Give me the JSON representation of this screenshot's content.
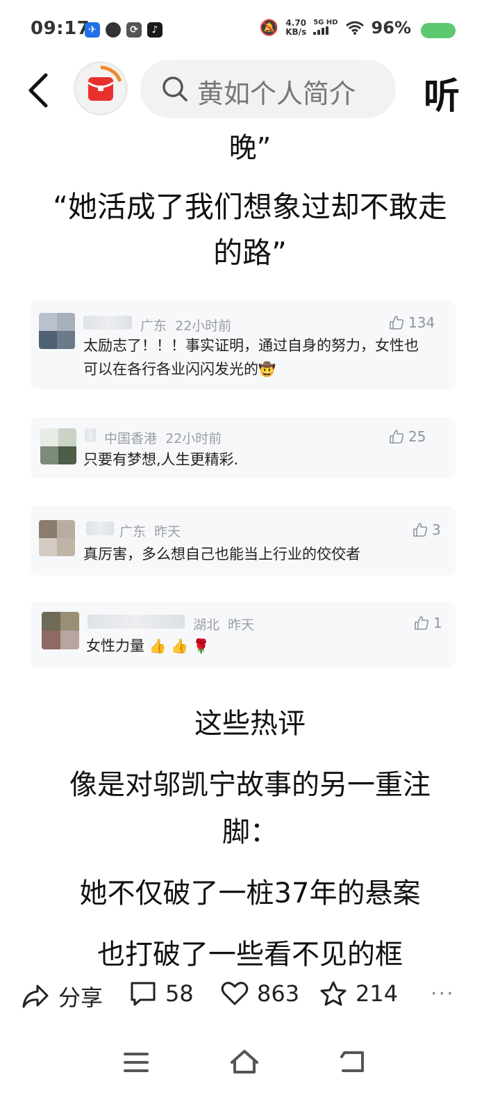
{
  "status_bar": {
    "time": "09:17",
    "speed_value": "4.70",
    "speed_unit": "KB/s",
    "net_label": "5G HD",
    "battery_pct": "96%"
  },
  "topnav": {
    "search_placeholder": "黄如个人简介",
    "listen_label": "听"
  },
  "article_top": {
    "line_cut": "晚”",
    "quote_line_1": "“她活成了我们想象过却不敢走",
    "quote_line_2": "的路”"
  },
  "comments": [
    {
      "region": "广东",
      "time": "22小时前",
      "likes": "134",
      "text_line_1": "太励志了！！！事实证明，通过自身的努力，女性也",
      "text_line_2": "可以在各行各业闪闪发光的",
      "emoji": "🤠"
    },
    {
      "region": "中国香港",
      "time": "22小时前",
      "likes": "25",
      "text_line_1": "只要有梦想,人生更精彩."
    },
    {
      "region": "广东",
      "time": "昨天",
      "likes": "3",
      "text_line_1": "真厉害，多么想自己也能当上行业的佼佼者"
    },
    {
      "region": "湖北",
      "time": "昨天",
      "likes": "1",
      "text_line_1": "女性力量",
      "emoji": "👍 👍 🌹"
    }
  ],
  "article_bottom": {
    "line_1": "这些热评",
    "line_2": "像是对邬凯宁故事的另一重注",
    "line_3": "脚：",
    "line_4": "她不仅破了一桩37年的悬案",
    "line_5": "也打破了一些看不见的框"
  },
  "actions": {
    "share_label": "分享",
    "comment_count": "58",
    "like_count": "863",
    "favorite_count": "214",
    "more_label": "···"
  },
  "colors": {
    "accent_red": "#e8312d",
    "battery_green": "#5cc870",
    "card_bg": "#f7f8fa"
  }
}
